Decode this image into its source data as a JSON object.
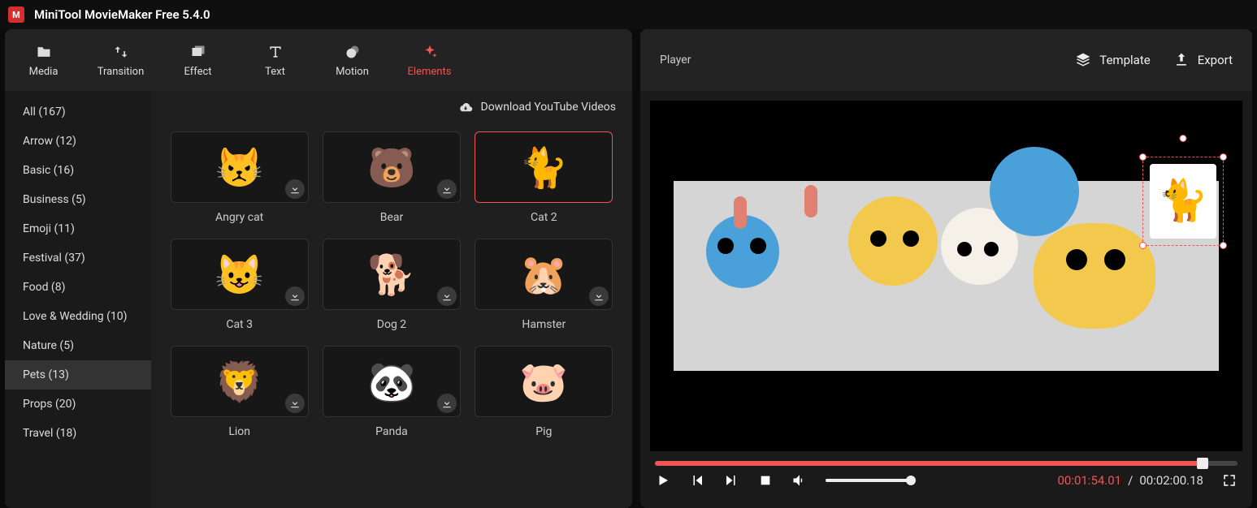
{
  "app_title": "MiniTool MovieMaker Free 5.4.0",
  "toolbar": [
    {
      "id": "media",
      "label": "Media",
      "svg": "folder"
    },
    {
      "id": "transition",
      "label": "Transition",
      "svg": "swap"
    },
    {
      "id": "effect",
      "label": "Effect",
      "svg": "layers"
    },
    {
      "id": "text",
      "label": "Text",
      "svg": "text"
    },
    {
      "id": "motion",
      "label": "Motion",
      "svg": "circle"
    },
    {
      "id": "elements",
      "label": "Elements",
      "svg": "sparkle"
    }
  ],
  "toolbar_active": "elements",
  "sidebar": [
    {
      "label": "All (167)"
    },
    {
      "label": "Arrow (12)"
    },
    {
      "label": "Basic (16)"
    },
    {
      "label": "Business (5)"
    },
    {
      "label": "Emoji (11)"
    },
    {
      "label": "Festival (37)"
    },
    {
      "label": "Food (8)"
    },
    {
      "label": "Love & Wedding (10)"
    },
    {
      "label": "Nature (5)"
    },
    {
      "label": "Pets (13)"
    },
    {
      "label": "Props (20)"
    },
    {
      "label": "Travel (18)"
    }
  ],
  "sidebar_active_index": 9,
  "grid_header_link": "Download YouTube Videos",
  "elements": [
    {
      "label": "Angry cat",
      "download": true,
      "selected": false,
      "emoji": "😾",
      "bg": "#fff"
    },
    {
      "label": "Bear",
      "download": true,
      "selected": false,
      "emoji": "🐻",
      "bg": ""
    },
    {
      "label": "Cat 2",
      "download": false,
      "selected": true,
      "emoji": "🐈",
      "bg": ""
    },
    {
      "label": "Cat 3",
      "download": true,
      "selected": false,
      "emoji": "😺",
      "bg": ""
    },
    {
      "label": "Dog 2",
      "download": true,
      "selected": false,
      "emoji": "🐕",
      "bg": ""
    },
    {
      "label": "Hamster",
      "download": true,
      "selected": false,
      "emoji": "🐹",
      "bg": ""
    },
    {
      "label": "Lion",
      "download": true,
      "selected": false,
      "emoji": "🦁",
      "bg": ""
    },
    {
      "label": "Panda",
      "download": true,
      "selected": false,
      "emoji": "🐼",
      "bg": ""
    },
    {
      "label": "Pig",
      "download": false,
      "selected": false,
      "emoji": "🐷",
      "bg": ""
    }
  ],
  "player": {
    "title": "Player",
    "template_label": "Template",
    "export_label": "Export",
    "current_time": "00:01:54.01",
    "duration": "00:02:00.18",
    "progress_pct": 94,
    "volume_pct": 95
  }
}
